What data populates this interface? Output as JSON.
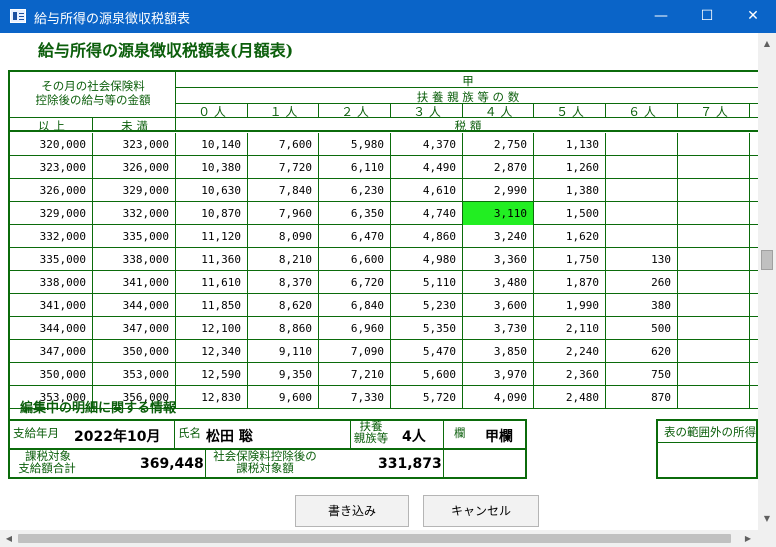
{
  "window": {
    "title": "給与所得の源泉徴収税額表",
    "min_glyph": "—",
    "max_glyph": "☐",
    "close_glyph": "✕"
  },
  "heading": "給与所得の源泉徴収税額表(月額表)",
  "table": {
    "header_left_line1": "その月の社会保険料",
    "header_left_line2": "控除後の給与等の金額",
    "header_ko": "甲",
    "header_dependents": "扶 養 親 族 等 の 数",
    "header_from": "以 上",
    "header_to": "未 満",
    "header_tax": "税 額",
    "dependent_cols": [
      "０ 人",
      "１ 人",
      "２ 人",
      "３ 人",
      "４ 人",
      "５ 人",
      "６ 人",
      "７ 人"
    ],
    "rows": [
      [
        "320,000",
        "323,000",
        "10,140",
        "7,600",
        "5,980",
        "4,370",
        "2,750",
        "1,130",
        "",
        ""
      ],
      [
        "323,000",
        "326,000",
        "10,380",
        "7,720",
        "6,110",
        "4,490",
        "2,870",
        "1,260",
        "",
        ""
      ],
      [
        "326,000",
        "329,000",
        "10,630",
        "7,840",
        "6,230",
        "4,610",
        "2,990",
        "1,380",
        "",
        ""
      ],
      [
        "329,000",
        "332,000",
        "10,870",
        "7,960",
        "6,350",
        "4,740",
        "3,110",
        "1,500",
        "",
        ""
      ],
      [
        "332,000",
        "335,000",
        "11,120",
        "8,090",
        "6,470",
        "4,860",
        "3,240",
        "1,620",
        "",
        ""
      ],
      [
        "335,000",
        "338,000",
        "11,360",
        "8,210",
        "6,600",
        "4,980",
        "3,360",
        "1,750",
        "130",
        ""
      ],
      [
        "338,000",
        "341,000",
        "11,610",
        "8,370",
        "6,720",
        "5,110",
        "3,480",
        "1,870",
        "260",
        ""
      ],
      [
        "341,000",
        "344,000",
        "11,850",
        "8,620",
        "6,840",
        "5,230",
        "3,600",
        "1,990",
        "380",
        ""
      ],
      [
        "344,000",
        "347,000",
        "12,100",
        "8,860",
        "6,960",
        "5,350",
        "3,730",
        "2,110",
        "500",
        ""
      ],
      [
        "347,000",
        "350,000",
        "12,340",
        "9,110",
        "7,090",
        "5,470",
        "3,850",
        "2,240",
        "620",
        ""
      ],
      [
        "350,000",
        "353,000",
        "12,590",
        "9,350",
        "7,210",
        "5,600",
        "3,970",
        "2,360",
        "750",
        ""
      ],
      [
        "353,000",
        "356,000",
        "12,830",
        "9,600",
        "7,330",
        "5,720",
        "4,090",
        "2,480",
        "870",
        ""
      ]
    ],
    "highlight_row": 3,
    "highlight_col": 6,
    "highlight_color": "#22ee22"
  },
  "info": {
    "section_title": "編集中の明細に関する情報",
    "pay_month_label": "支給年月",
    "pay_month_value": "2022年10月",
    "name_label": "氏名",
    "name_value": "松田 聡",
    "dependents_label_line1": "扶養",
    "dependents_label_line2": "親族等",
    "dependents_value": "4人",
    "column_label": "欄",
    "column_value": "甲欄",
    "taxable_total_label_line1": "課税対象",
    "taxable_total_label_line2": "支給額合計",
    "taxable_total_value": "369,448",
    "after_insurance_label_line1": "社会保険料控除後の",
    "after_insurance_label_line2": "課税対象額",
    "after_insurance_value": "331,873",
    "outside_label": "表の範囲外の所得"
  },
  "buttons": {
    "write": "書き込み",
    "cancel": "キャンセル"
  },
  "colors": {
    "titlebar": "#0a64c8",
    "accent_green": "#0b6b0b"
  }
}
